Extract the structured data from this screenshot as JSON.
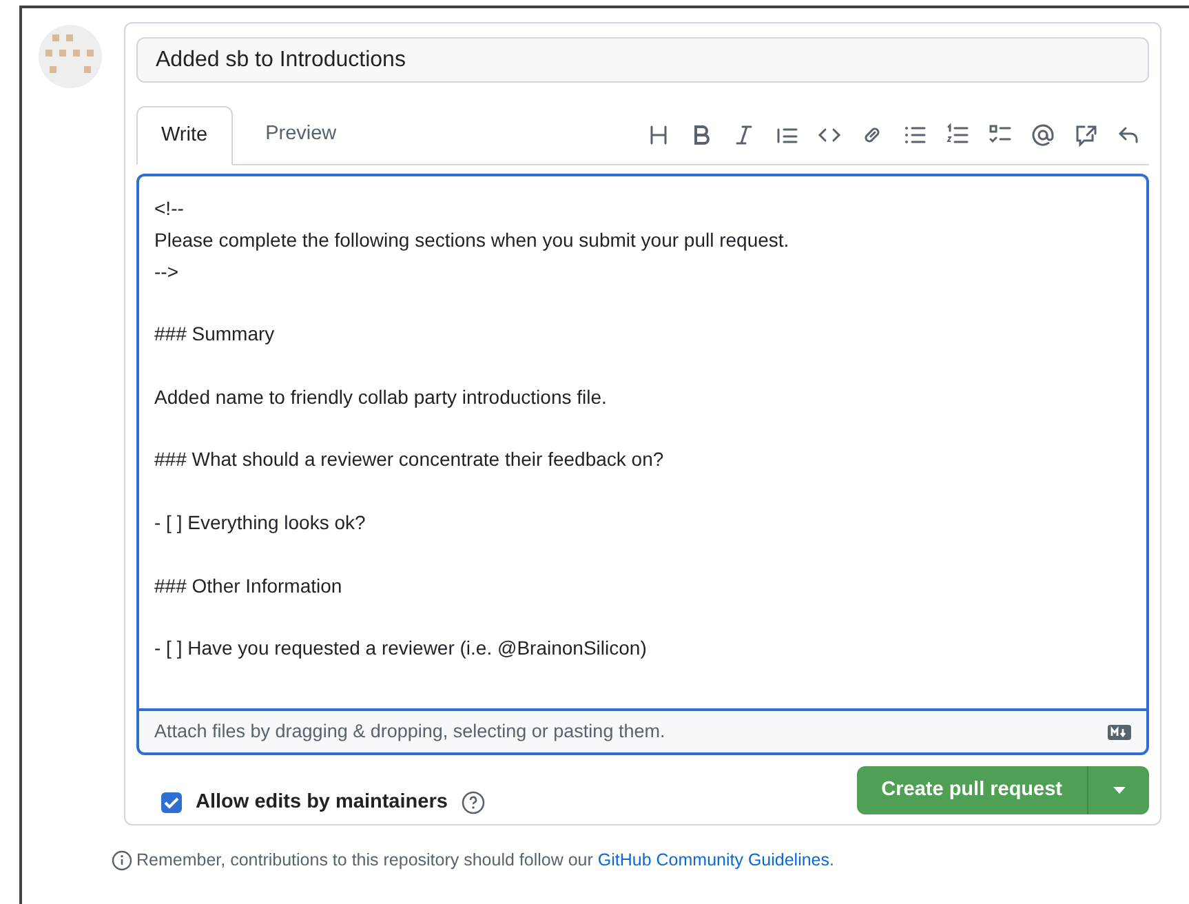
{
  "title_field": {
    "value": "Added sb to Introductions"
  },
  "tabs": [
    {
      "label": "Write",
      "selected": true
    },
    {
      "label": "Preview",
      "selected": false
    }
  ],
  "editor": {
    "value": "<!--\nPlease complete the following sections when you submit your pull request.\n-->\n\n### Summary\n\nAdded name to friendly collab party introductions file.\n\n### What should a reviewer concentrate their feedback on?\n\n- [ ] Everything looks ok?\n\n### Other Information\n\n- [ ] Have you requested a reviewer (i.e. @BrainonSilicon)",
    "footer": "Attach files by dragging & dropping, selecting or pasting them."
  },
  "allow_edits": {
    "label": "Allow edits by maintainers",
    "checked": true
  },
  "submit_button": {
    "label": "Create pull request"
  },
  "note": {
    "text": "Remember, contributions to this repository should follow our ",
    "link": "GitHub Community Guidelines",
    "end": "."
  }
}
